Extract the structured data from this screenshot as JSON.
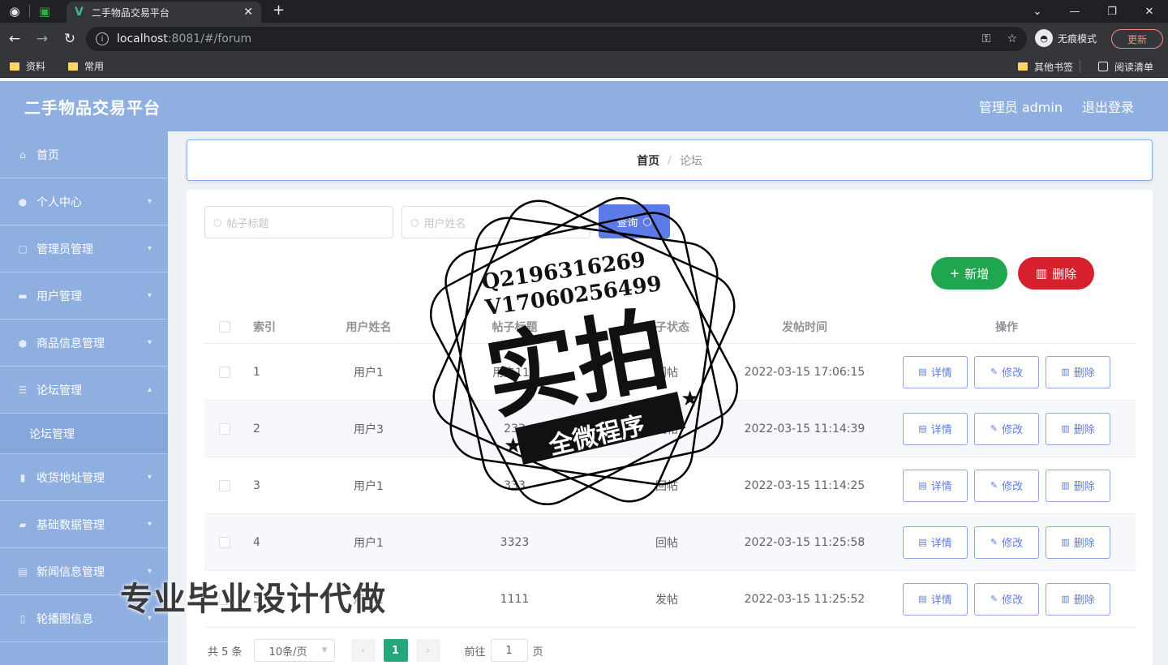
{
  "browser": {
    "tab_title": "二手物品交易平台",
    "tab_close": "✕",
    "new_tab": "+",
    "url_host": "localhost",
    "url_path": ":8081/#/forum",
    "incognito_label": "无痕模式",
    "update_label": "更新",
    "bookmarks": [
      "资料",
      "常用"
    ],
    "other_bookmarks": "其他书签",
    "reading_list": "阅读清单"
  },
  "header": {
    "title": "二手物品交易平台",
    "admin_label": "管理员 admin",
    "logout_label": "退出登录"
  },
  "sidebar": {
    "items": [
      {
        "label": "首页",
        "icon": "home-icon"
      },
      {
        "label": "个人中心",
        "icon": "user-icon"
      },
      {
        "label": "管理员管理",
        "icon": "admin-icon"
      },
      {
        "label": "用户管理",
        "icon": "users-icon"
      },
      {
        "label": "商品信息管理",
        "icon": "goods-icon"
      },
      {
        "label": "论坛管理",
        "icon": "forum-icon"
      },
      {
        "label": "论坛管理",
        "icon": ""
      },
      {
        "label": "收货地址管理",
        "icon": "address-icon"
      },
      {
        "label": "基础数据管理",
        "icon": "data-icon"
      },
      {
        "label": "新闻信息管理",
        "icon": "news-icon"
      },
      {
        "label": "轮播图信息",
        "icon": "carousel-icon"
      }
    ]
  },
  "breadcrumb": {
    "home": "首页",
    "separator": "/",
    "current": "论坛"
  },
  "search": {
    "title_placeholder": "帖子标题",
    "user_placeholder": "用户姓名",
    "query_label": "查询"
  },
  "actions": {
    "add_label": "新增",
    "delete_label": "删除"
  },
  "table": {
    "columns": [
      "索引",
      "用户姓名",
      "帖子标题",
      "帖子状态",
      "发帖时间",
      "操作"
    ],
    "rows": [
      {
        "index": "1",
        "user": "用户1",
        "title": "用户111",
        "type": "回帖",
        "time": "2022-03-15 17:06:15"
      },
      {
        "index": "2",
        "user": "用户3",
        "title": "233",
        "type": "回帖",
        "time": "2022-03-15 11:14:39"
      },
      {
        "index": "3",
        "user": "用户1",
        "title": "333",
        "type": "回帖",
        "time": "2022-03-15 11:14:25"
      },
      {
        "index": "4",
        "user": "用户1",
        "title": "3323",
        "type": "回帖",
        "time": "2022-03-15 11:25:58"
      },
      {
        "index": "5",
        "user": "用户1",
        "title": "1111",
        "type": "发帖",
        "time": "2022-03-15 11:25:52"
      }
    ],
    "op_detail": "详情",
    "op_edit": "修改",
    "op_delete": "删除"
  },
  "pagination": {
    "total": "共 5 条",
    "page_size": "10条/页",
    "current_page": "1",
    "goto_prefix": "前往",
    "goto_value": "1",
    "goto_suffix": "页"
  },
  "watermark": {
    "qq": "Q2196316269",
    "wechat": "V17060256499",
    "big": "实拍",
    "ribbon": "全微程序",
    "caption": "专业毕业设计代做"
  },
  "colors": {
    "header_bg": "#8fafe0",
    "primary": "#5d7be8",
    "add_green": "#21a650",
    "delete_red": "#d6202d",
    "page_active": "#25a77b"
  }
}
